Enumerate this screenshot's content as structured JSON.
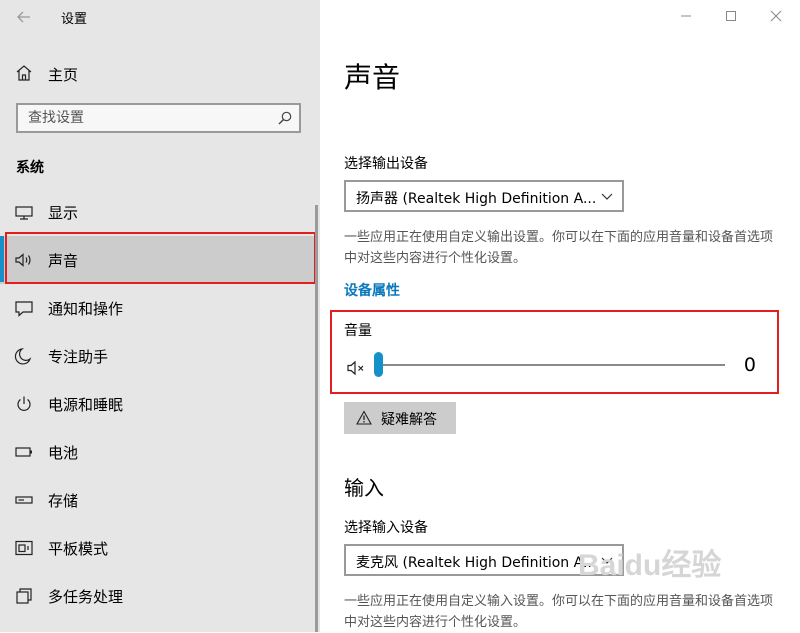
{
  "window": {
    "title": "设置",
    "controls": [
      "minimize-icon",
      "maximize-icon",
      "close-icon"
    ]
  },
  "sidebar": {
    "home_label": "主页",
    "search_placeholder": "查找设置",
    "section_label": "系统",
    "items": [
      {
        "label": "显示",
        "icon": "display-icon"
      },
      {
        "label": "声音",
        "icon": "speaker-icon",
        "selected": true
      },
      {
        "label": "通知和操作",
        "icon": "notification-icon"
      },
      {
        "label": "专注助手",
        "icon": "moon-icon"
      },
      {
        "label": "电源和睡眠",
        "icon": "power-icon"
      },
      {
        "label": "电池",
        "icon": "battery-icon"
      },
      {
        "label": "存储",
        "icon": "storage-icon"
      },
      {
        "label": "平板模式",
        "icon": "tablet-mode-icon"
      },
      {
        "label": "多任务处理",
        "icon": "multitasking-icon"
      }
    ]
  },
  "main": {
    "title": "声音",
    "output": {
      "label": "选择输出设备",
      "device": "扬声器 (Realtek High Definition A...",
      "description": "一些应用正在使用自定义输出设置。你可以在下面的应用音量和设备首选项中对这些内容进行个性化设置。",
      "properties_link": "设备属性"
    },
    "volume": {
      "label": "音量",
      "value": "0",
      "muted": true
    },
    "troubleshoot_label": "疑难解答",
    "input": {
      "section_title": "输入",
      "label": "选择输入设备",
      "device": "麦克风 (Realtek High Definition A...",
      "description": "一些应用正在使用自定义输入设置。你可以在下面的应用音量和设备首选项中对这些内容进行个性化设置。"
    }
  },
  "watermark": "Baidu经验",
  "colors": {
    "sidebar_bg": "#e6e6e6",
    "selected_bg": "#cccccc",
    "accent": "#1590c9",
    "link": "#0a78bd",
    "highlight_box": "#e31e1e"
  }
}
